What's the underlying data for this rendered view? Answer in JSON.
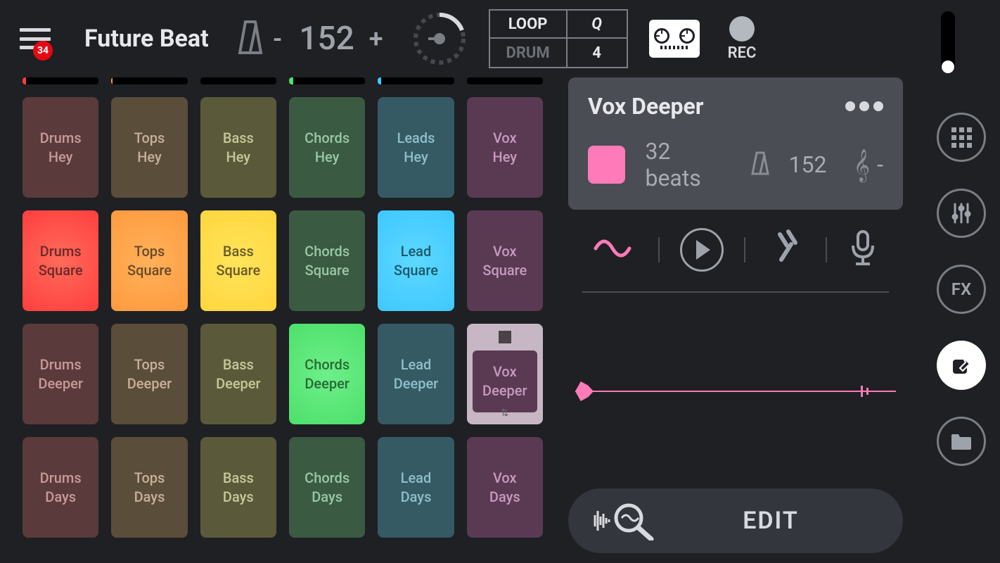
{
  "menu": {
    "badge": "34"
  },
  "title": "Future Beat",
  "tempo": {
    "value": "152",
    "minus": "-",
    "plus": "+"
  },
  "mode": {
    "loop": "LOOP",
    "drum": "DRUM",
    "q": "Q",
    "qval": "4"
  },
  "rec": {
    "label": "REC"
  },
  "columns": [
    {
      "meter_color": "#ff3e3e",
      "meter_pct": 5,
      "pads": [
        {
          "label": "Drums\nHey",
          "style": "dim"
        },
        {
          "label": "Drums\nSquare",
          "style": "bright"
        },
        {
          "label": "Drums\nDeeper",
          "style": "dim"
        },
        {
          "label": "Drums\nDays",
          "style": "dim"
        }
      ]
    },
    {
      "meter_color": "#ff9a3e",
      "meter_pct": 2,
      "pads": [
        {
          "label": "Tops\nHey",
          "style": "dim"
        },
        {
          "label": "Tops\nSquare",
          "style": "bright"
        },
        {
          "label": "Tops\nDeeper",
          "style": "dim"
        },
        {
          "label": "Tops\nDays",
          "style": "dim"
        }
      ]
    },
    {
      "meter_color": "#ffd63e",
      "meter_pct": 0,
      "pads": [
        {
          "label": "Bass\nHey",
          "style": "dim"
        },
        {
          "label": "Bass\nSquare",
          "style": "bright"
        },
        {
          "label": "Bass\nDeeper",
          "style": "dim"
        },
        {
          "label": "Bass\nDays",
          "style": "dim"
        }
      ]
    },
    {
      "meter_color": "#4de06a",
      "meter_pct": 6,
      "pads": [
        {
          "label": "Chords\nHey",
          "style": "dim"
        },
        {
          "label": "Chords\nSquare",
          "style": "dim"
        },
        {
          "label": "Chords\nDeeper",
          "style": "bright"
        },
        {
          "label": "Chords\nDays",
          "style": "dim"
        }
      ]
    },
    {
      "meter_color": "#3ec8ff",
      "meter_pct": 4,
      "pads": [
        {
          "label": "Leads\nHey",
          "style": "dim"
        },
        {
          "label": "Lead\nSquare",
          "style": "bright"
        },
        {
          "label": "Lead\nDeeper",
          "style": "dim"
        },
        {
          "label": "Lead\nDays",
          "style": "dim"
        }
      ]
    },
    {
      "meter_color": "#ff7ab8",
      "meter_pct": 0,
      "pads": [
        {
          "label": "Vox\nHey",
          "style": "dim"
        },
        {
          "label": "Vox\nSquare",
          "style": "dim"
        },
        {
          "label": "Vox\nDeeper",
          "style": "sel"
        },
        {
          "label": "Vox\nDays",
          "style": "dim"
        }
      ]
    }
  ],
  "detail": {
    "title": "Vox Deeper",
    "swatch": "#ff7ab8",
    "beats": "32 beats",
    "bpm": "152",
    "clef": "-"
  },
  "edit": {
    "label": "EDIT"
  },
  "side": {
    "fx": "FX"
  }
}
